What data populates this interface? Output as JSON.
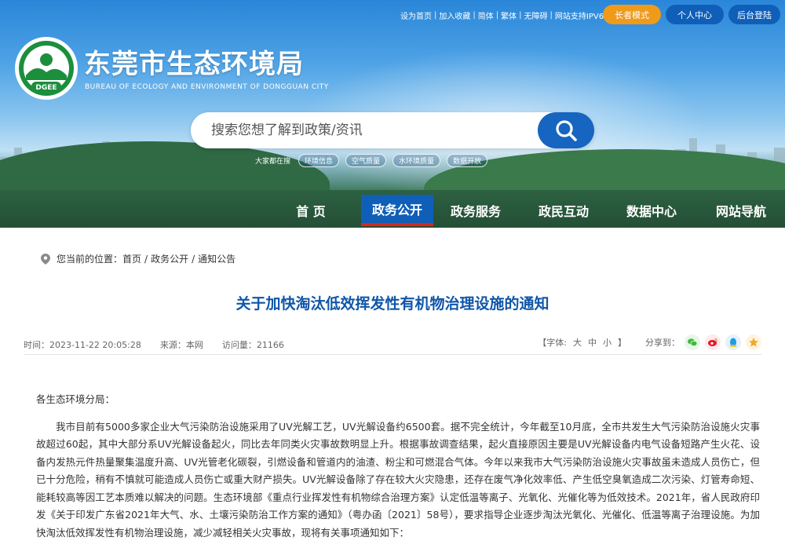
{
  "top_links": [
    "设为首页",
    "加入收藏",
    "简体",
    "繁体",
    "无障碍",
    "网站支持IPV6"
  ],
  "top_buttons": {
    "elder": "长者模式",
    "personal": "个人中心",
    "login": "后台登陆"
  },
  "site": {
    "title": "东莞市生态环境局",
    "subtitle": "BUREAU OF ECOLOGY AND ENVIRONMENT OF DONGGUAN CITY",
    "logo_text": "DGEE"
  },
  "search": {
    "placeholder": "搜索您想了解到政策/资讯"
  },
  "hot": {
    "label": "大家都在搜",
    "items": [
      "环境信息",
      "空气质量",
      "水环境质量",
      "数据开放"
    ]
  },
  "nav": [
    "首 页",
    "政务公开",
    "政务服务",
    "政民互动",
    "数据中心",
    "网站导航"
  ],
  "nav_active": "政务公开",
  "breadcrumb": {
    "prefix": "您当前的位置：",
    "items": [
      "首页",
      "政务公开",
      "通知公告"
    ],
    "separator": "/"
  },
  "article": {
    "title": "关于加快淘汰低效挥发性有机物治理设施的通知",
    "time": "时间：2023-11-22 20:05:28",
    "source": "来源：本网",
    "visits": "访问量：21166",
    "font_label": "【字体:",
    "font_sizes": [
      "大",
      "中",
      "小"
    ],
    "font_end": "】",
    "share_label": "分享到：",
    "greeting": "各生态环境分局：",
    "paragraph": "我市目前有5000多家企业大气污染防治设施采用了UV光解工艺，UV光解设备约6500套。据不完全统计，今年截至10月底，全市共发生大气污染防治设施火灾事故超过60起，其中大部分系UV光解设备起火，同比去年同类火灾事故数明显上升。根据事故调查结果，起火直接原因主要是UV光解设备内电气设备短路产生火花、设备内发热元件热量聚集温度升高、UV光管老化碳裂，引燃设备和管道内的油渣、粉尘和可燃混合气体。今年以来我市大气污染防治设施火灾事故虽未造成人员伤亡，但已十分危险，稍有不慎就可能造成人员伤亡或重大财产损失。UV光解设备除了存在较大火灾隐患，还存在废气净化效率低、产生低空臭氧造成二次污染、灯管寿命短、能耗较高等因工艺本质难以解决的问题。生态环境部《重点行业挥发性有机物综合治理方案》认定低温等离子、光氧化、光催化等为低效技术。2021年，省人民政府印发《关于印发广东省2021年大气、水、土壤污染防治工作方案的通知》（粤办函〔2021〕58号），要求指导企业逐步淘汰光氧化、光催化、低温等离子治理设施。为加快淘汰低效挥发性有机物治理设施，减少减轻相关火灾事故，现将有关事项通知如下："
  },
  "colors": {
    "brand_blue": "#0f5fb9",
    "title_blue": "#0f56a8",
    "accent_orange": "#f09a1a",
    "nav_underline": "#e2231a"
  }
}
